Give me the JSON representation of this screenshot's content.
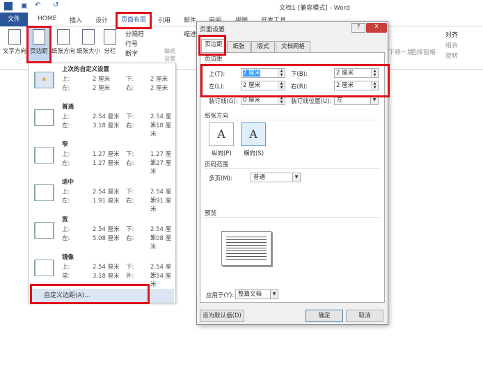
{
  "window": {
    "title": "文档1 [兼容模式] - Word"
  },
  "tabs": {
    "file": "文件",
    "items": [
      "HOME",
      "插入",
      "设计",
      "页面布局",
      "引用",
      "邮件",
      "审阅",
      "视图",
      "开发工具"
    ]
  },
  "ribbon": {
    "text_direction": "文字方向",
    "margins": "页边距",
    "orientation": "纸张方向",
    "size": "纸张大小",
    "columns": "分栏",
    "breaks": "分隔符",
    "line_numbers": "行号",
    "hyphenation": "断字",
    "draft": "稿纸设置",
    "indent": "缩进",
    "send_backward": "下移一层",
    "selection_pane": "选择窗格",
    "align": "对齐",
    "group": "组合",
    "rotate": "旋转"
  },
  "margins_menu": {
    "items": [
      {
        "name": "上次的自定义设置",
        "l1": "上:",
        "v1": "2 厘米",
        "l2": "下:",
        "v2": "2 厘米",
        "l3": "左:",
        "v3": "2 厘米",
        "l4": "右:",
        "v4": "2 厘米"
      },
      {
        "name": "普通",
        "l1": "上:",
        "v1": "2.54 厘米",
        "l2": "下:",
        "v2": "2.54 厘米",
        "l3": "左:",
        "v3": "3.18 厘米",
        "l4": "右:",
        "v4": "3.18 厘米"
      },
      {
        "name": "窄",
        "l1": "上:",
        "v1": "1.27 厘米",
        "l2": "下:",
        "v2": "1.27 厘米",
        "l3": "左:",
        "v3": "1.27 厘米",
        "l4": "右:",
        "v4": "1.27 厘米"
      },
      {
        "name": "适中",
        "l1": "上:",
        "v1": "2.54 厘米",
        "l2": "下:",
        "v2": "2.54 厘米",
        "l3": "左:",
        "v3": "1.91 厘米",
        "l4": "右:",
        "v4": "1.91 厘米"
      },
      {
        "name": "宽",
        "l1": "上:",
        "v1": "2.54 厘米",
        "l2": "下:",
        "v2": "2.54 厘米",
        "l3": "左:",
        "v3": "5.08 厘米",
        "l4": "右:",
        "v4": "5.08 厘米"
      },
      {
        "name": "镜像",
        "l1": "上:",
        "v1": "2.54 厘米",
        "l2": "下:",
        "v2": "2.54 厘米",
        "l3": "里:",
        "v3": "3.18 厘米",
        "l4": "外:",
        "v4": "2.54 厘米"
      }
    ],
    "custom": "自定义边距(A)..."
  },
  "dialog": {
    "title": "页面设置",
    "help": "?",
    "close": "x",
    "tabs": [
      "页边距",
      "纸张",
      "版式",
      "文档网格"
    ],
    "margins_section": "页边距",
    "top_label": "上(T):",
    "top": "2 厘米",
    "bottom_label": "下(B):",
    "bottom": "2 厘米",
    "left_label": "左(L):",
    "left": "2 厘米",
    "right_label": "右(R):",
    "right": "2 厘米",
    "gutter_label": "装订线(G):",
    "gutter": "0 厘米",
    "gutter_pos_label": "装订线位置(U):",
    "gutter_pos": "左",
    "orientation_section": "纸张方向",
    "portrait": "纵向(P)",
    "landscape": "横向(S)",
    "icon_letter": "A",
    "pages_section": "页码范围",
    "multiple_label": "多页(M):",
    "multiple": "普通",
    "preview_section": "预览",
    "apply_label": "应用于(Y):",
    "apply": "整篇文档",
    "default_btn": "设为默认值(D)",
    "ok": "确定",
    "cancel": "取消"
  }
}
